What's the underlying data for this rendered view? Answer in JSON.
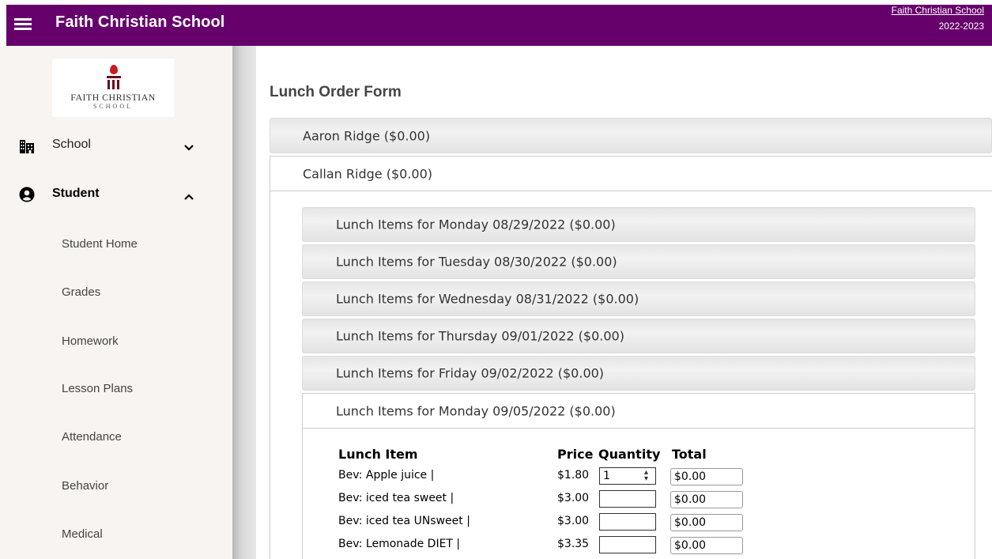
{
  "header": {
    "title": "Faith Christian School",
    "school_link": "Faith Christian School",
    "school_year": "2022-2023",
    "color": "#66006b"
  },
  "logo": {
    "name_text": "FAITH CHRISTIAN",
    "sub_text": "SCHOOL"
  },
  "sidebar": {
    "school": {
      "label": "School",
      "icon": "building-icon",
      "chevron": "⌄"
    },
    "student": {
      "label": "Student",
      "icon": "user-circle-icon",
      "chevron": "^"
    },
    "sub_items": [
      "Student Home",
      "Grades",
      "Homework",
      "Lesson Plans",
      "Attendance",
      "Behavior",
      "Medical"
    ]
  },
  "main": {
    "title": "Lunch Order Form",
    "students": [
      "Aaron Ridge ($0.00)",
      "Callan Ridge ($0.00)"
    ],
    "days": [
      "Lunch Items for Monday 08/29/2022 ($0.00)",
      "Lunch Items for Tuesday 08/30/2022 ($0.00)",
      "Lunch Items for Wednesday 08/31/2022 ($0.00)",
      "Lunch Items for Thursday 09/01/2022 ($0.00)",
      "Lunch Items for Friday 09/02/2022 ($0.00)",
      "Lunch Items for Monday 09/05/2022 ($0.00)"
    ],
    "table": {
      "headers": [
        "Lunch Item",
        "Price",
        "Quantity",
        "Total"
      ],
      "rows": [
        {
          "item": "Bev: Apple juice |",
          "price": "$1.80",
          "qty": "1",
          "total": "$0.00"
        },
        {
          "item": "Bev: iced tea sweet |",
          "price": "$3.00",
          "qty": "",
          "total": "$0.00"
        },
        {
          "item": "Bev: iced tea UNsweet |",
          "price": "$3.00",
          "qty": "",
          "total": "$0.00"
        },
        {
          "item": "Bev: Lemonade DIET |",
          "price": "$3.35",
          "qty": "",
          "total": "$0.00"
        }
      ]
    }
  }
}
